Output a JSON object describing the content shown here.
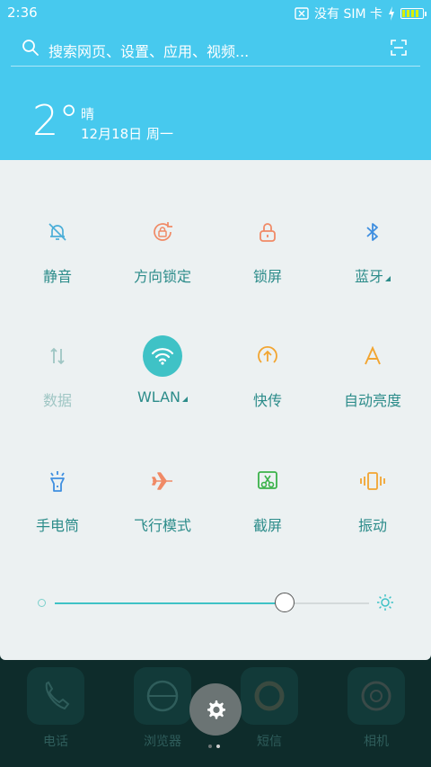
{
  "status_bar": {
    "time": "2:36",
    "sim_text": "没有 SIM 卡",
    "icons": [
      "sim-x-icon",
      "charging-icon",
      "battery-icon"
    ]
  },
  "search": {
    "placeholder": "搜索网页、设置、应用、视频...",
    "icons": [
      "search-icon",
      "scan-icon"
    ]
  },
  "weather": {
    "temperature": "2°",
    "condition": "晴",
    "date": "12月18日 周一"
  },
  "quick_settings": {
    "tiles": [
      {
        "label": "静音",
        "icon": "bell-off-icon",
        "color": "#4aaed8",
        "active": false
      },
      {
        "label": "方向锁定",
        "icon": "rotation-lock-icon",
        "color": "#f08a66",
        "active": false
      },
      {
        "label": "锁屏",
        "icon": "lock-icon",
        "color": "#f08a66",
        "active": false
      },
      {
        "label": "蓝牙",
        "icon": "bluetooth-icon",
        "color": "#3f8fe0",
        "active": false,
        "has_menu": true
      },
      {
        "label": "数据",
        "icon": "data-icon",
        "color": "#9fc6c4",
        "active": false,
        "disabled": true
      },
      {
        "label": "WLAN",
        "icon": "wifi-icon",
        "color": "#3fc2c6",
        "active": true,
        "has_menu": true
      },
      {
        "label": "快传",
        "icon": "share-icon",
        "color": "#f2a531",
        "active": false
      },
      {
        "label": "自动亮度",
        "icon": "auto-brightness-icon",
        "color": "#f2a531",
        "active": false
      },
      {
        "label": "手电筒",
        "icon": "flashlight-icon",
        "color": "#3f8fe0",
        "active": false
      },
      {
        "label": "飞行模式",
        "icon": "airplane-icon",
        "color": "#f08a66",
        "active": false
      },
      {
        "label": "截屏",
        "icon": "screenshot-icon",
        "color": "#3bb24a",
        "active": false
      },
      {
        "label": "振动",
        "icon": "vibrate-icon",
        "color": "#f2a531",
        "active": false
      }
    ],
    "brightness": {
      "value": 0.73,
      "icons": [
        "brightness-low-icon",
        "brightness-high-icon"
      ]
    }
  },
  "dock": {
    "apps": [
      {
        "label": "电话",
        "icon": "phone-icon"
      },
      {
        "label": "浏览器",
        "icon": "browser-icon"
      },
      {
        "label": "短信",
        "icon": "message-icon"
      },
      {
        "label": "相机",
        "icon": "camera-icon"
      }
    ],
    "settings_button_icon": "gear-icon",
    "page_count": 2,
    "current_page": 2
  }
}
